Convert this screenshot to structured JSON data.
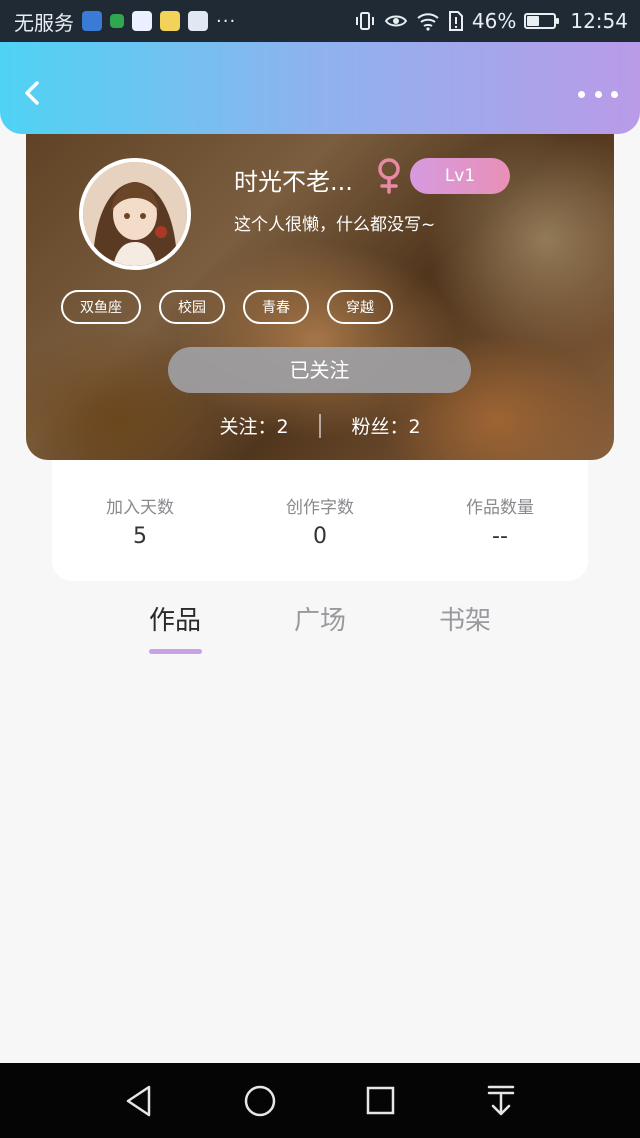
{
  "status_bar": {
    "carrier": "无服务",
    "more_indicator": "···",
    "battery_percent": "46%",
    "battery_level": 0.46,
    "time": "12:54",
    "icons": [
      "shield-app-icon",
      "chat-app-icon",
      "baidu-app-icon",
      "emoji-app-icon",
      "browser-app-icon",
      "vibrate-icon",
      "eye-icon",
      "wifi-icon",
      "sim-alert-icon",
      "battery-icon"
    ]
  },
  "header": {
    "back_icon": "chevron-left-icon",
    "more_icon": "more-dots-icon",
    "gradient": [
      "#4fd3f4",
      "#8fb2ee",
      "#b99be8"
    ]
  },
  "profile": {
    "username": "时光不老...",
    "gender_icon": "female-symbol-icon",
    "gender_color": "#e88aa6",
    "level": "Lv1",
    "bio": "这个人很懒，什么都没写~",
    "tags": [
      "双鱼座",
      "校园",
      "青春",
      "穿越"
    ],
    "follow_button": "已关注",
    "following": "关注：2",
    "followers": "粉丝：2"
  },
  "stats": [
    {
      "label": "加入天数",
      "value": "5"
    },
    {
      "label": "创作字数",
      "value": "0"
    },
    {
      "label": "作品数量",
      "value": "--"
    }
  ],
  "tabs": [
    {
      "label": "作品",
      "active": true
    },
    {
      "label": "广场",
      "active": false
    },
    {
      "label": "书架",
      "active": false
    }
  ],
  "nav_bar": {
    "buttons": [
      "back-triangle-icon",
      "home-circle-icon",
      "recents-square-icon",
      "download-arrow-icon"
    ]
  },
  "colors": {
    "accent": "#c9a2e4",
    "level_badge": "#e293c9",
    "follow_button_bg": "#a0a0a4"
  }
}
